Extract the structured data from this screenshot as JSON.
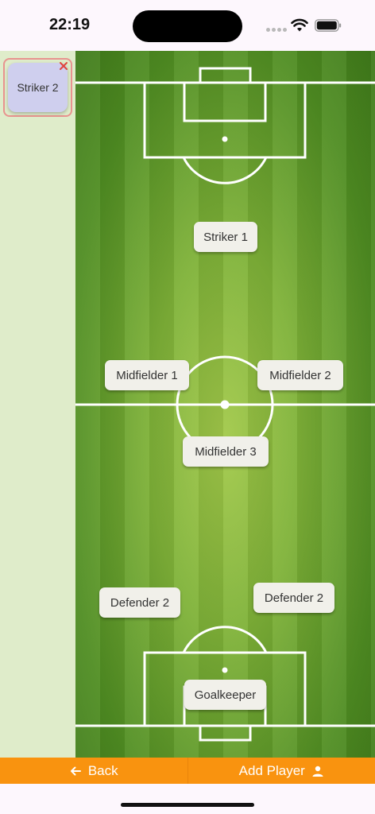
{
  "status_bar": {
    "time": "22:19"
  },
  "bench": {
    "players": [
      {
        "label": "Striker 2"
      }
    ],
    "accent_color": "#e8938f",
    "card_color": "#cfcfee",
    "remove_icon": "close-icon"
  },
  "pitch": {
    "players": [
      {
        "label": "Striker 1"
      },
      {
        "label": "Midfielder 1"
      },
      {
        "label": "Midfielder 2"
      },
      {
        "label": "Midfielder 3"
      },
      {
        "label": "Defender 2"
      },
      {
        "label": "Defender 2"
      },
      {
        "label": "Goalkeeper"
      }
    ]
  },
  "bottom_bar": {
    "back_label": "Back",
    "back_icon": "arrow-left-icon",
    "add_player_label": "Add Player",
    "add_player_icon": "person-icon",
    "color": "#f9930f"
  }
}
